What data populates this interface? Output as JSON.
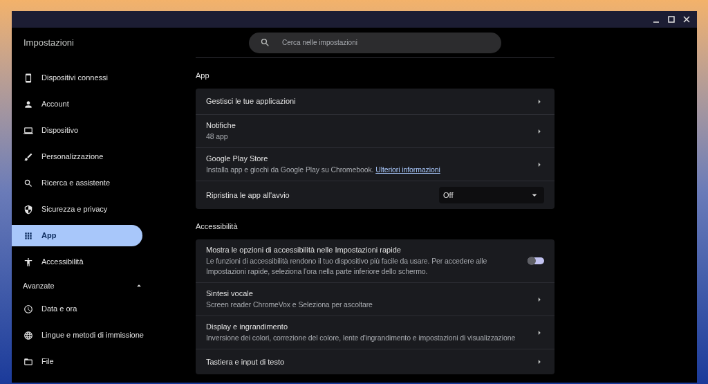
{
  "window": {
    "title": "Impostazioni"
  },
  "search": {
    "placeholder": "Cerca nelle impostazioni"
  },
  "sidebar": {
    "items": [
      {
        "label": "Dispositivi connessi",
        "selected": false
      },
      {
        "label": "Account",
        "selected": false
      },
      {
        "label": "Dispositivo",
        "selected": false
      },
      {
        "label": "Personalizzazione",
        "selected": false
      },
      {
        "label": "Ricerca e assistente",
        "selected": false
      },
      {
        "label": "Sicurezza e privacy",
        "selected": false
      },
      {
        "label": "App",
        "selected": true
      },
      {
        "label": "Accessibilità",
        "selected": false
      }
    ],
    "advanced": {
      "label": "Avanzate",
      "expanded": true,
      "items": [
        {
          "label": "Data e ora",
          "selected": false
        },
        {
          "label": "Lingue e metodi di immissione",
          "selected": false
        },
        {
          "label": "File",
          "selected": false
        }
      ]
    }
  },
  "sections": [
    {
      "title": "App",
      "rows": [
        {
          "kind": "nav",
          "title": "Gestisci le tue applicazioni"
        },
        {
          "kind": "nav",
          "title": "Notifiche",
          "subtitle": "48 app"
        },
        {
          "kind": "nav",
          "title": "Google Play Store",
          "subtitle": "Installa app e giochi da Google Play su Chromebook.",
          "link": "Ulteriori informazioni"
        },
        {
          "kind": "select",
          "title": "Ripristina le app all'avvio",
          "value": "Off"
        }
      ]
    },
    {
      "title": "Accessibilità",
      "rows": [
        {
          "kind": "toggle",
          "title": "Mostra le opzioni di accessibilità nelle Impostazioni rapide",
          "subtitle": "Le funzioni di accessibilità rendono il tuo dispositivo più facile da usare. Per accedere alle Impostazioni rapide, seleziona l'ora nella parte inferiore dello schermo.",
          "checked": false
        },
        {
          "kind": "nav",
          "title": "Sintesi vocale",
          "subtitle": "Screen reader ChromeVox e Seleziona per ascoltare"
        },
        {
          "kind": "nav",
          "title": "Display e ingrandimento",
          "subtitle": "Inversione dei colori, correzione del colore, lente d'ingrandimento e impostazioni di visualizzazione"
        },
        {
          "kind": "nav",
          "title": "Tastiera e input di testo"
        }
      ]
    }
  ]
}
